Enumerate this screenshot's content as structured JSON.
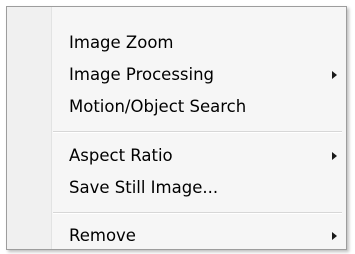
{
  "context_menu": {
    "items": [
      {
        "label": "Image Zoom",
        "has_submenu": false
      },
      {
        "label": "Image Processing",
        "has_submenu": true,
        "arrow_icon": "chevron-right-icon"
      },
      {
        "label": "Motion/Object Search",
        "has_submenu": false
      },
      {
        "label": "Aspect Ratio",
        "has_submenu": true,
        "arrow_icon": "chevron-right-icon"
      },
      {
        "label": "Save Still Image...",
        "has_submenu": false
      },
      {
        "label": "Remove",
        "has_submenu": true,
        "arrow_icon": "chevron-right-icon"
      }
    ]
  }
}
